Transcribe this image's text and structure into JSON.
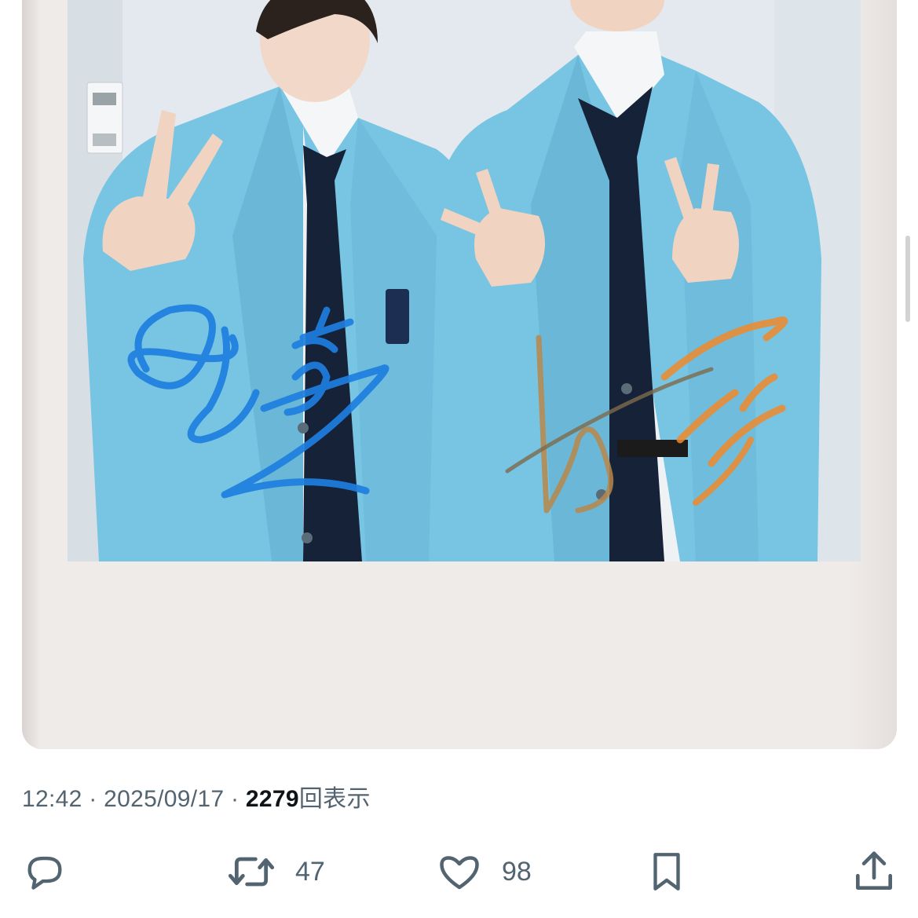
{
  "tweet": {
    "time": "12:42",
    "separator": "·",
    "date": "2025/09/17",
    "views_count": "2279",
    "views_label": "回表示"
  },
  "actions": {
    "reply": {
      "icon": "reply-icon",
      "count": ""
    },
    "retweet": {
      "icon": "retweet-icon",
      "count": "47"
    },
    "like": {
      "icon": "heart-icon",
      "count": "98"
    },
    "bookmark": {
      "icon": "bookmark-icon"
    },
    "share": {
      "icon": "share-icon"
    }
  },
  "media": {
    "type": "photo",
    "shows": "instant photo of two people in light blue blazers making peace signs, with a blue and a gold/orange signature"
  },
  "colors": {
    "text_primary": "#0f1419",
    "text_secondary": "#536471",
    "blazer": "#7cc8e6",
    "signature_blue": "#1e7fe0",
    "signature_gold": "#c98a3a"
  }
}
